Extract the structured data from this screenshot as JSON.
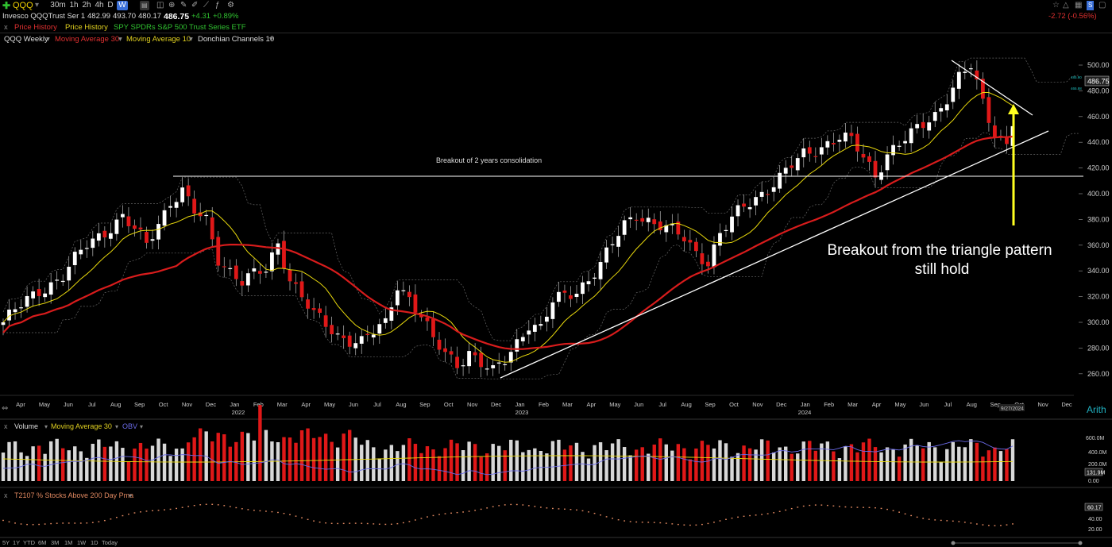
{
  "toolbar": {
    "symbol": "QQQ",
    "timeframes": [
      "30m",
      "1h",
      "2h",
      "4h",
      "D",
      "W"
    ],
    "active_timeframe": "W",
    "right_change": "-2.72 (-0.56%)"
  },
  "info": {
    "name": "Invesco QQQTrust Ser 1",
    "open": "482.99",
    "high": "493.70",
    "low": "480.17",
    "close": "486.75",
    "change": "+4.31",
    "change_pct": "+0.89%"
  },
  "tabs": [
    "Price History",
    "Price History",
    "SPY SPDRs S&P 500 Trust Series ETF"
  ],
  "studies": [
    {
      "label": "QQQ Weekly",
      "color": "#dddddd"
    },
    {
      "label": "Moving Average 30",
      "color": "#e03030"
    },
    {
      "label": "Moving Average 10",
      "color": "#e0d020"
    },
    {
      "label": "Donchian Channels 10",
      "color": "#dddddd"
    }
  ],
  "annotations": {
    "consolidation": "Breakout of 2 years consolidation",
    "triangle_line1": "Breakout from the triangle pattern",
    "triangle_line2": "still hold"
  },
  "price_axis": {
    "ticks": [
      "500.00",
      "480.00",
      "460.00",
      "440.00",
      "420.00",
      "400.00",
      "380.00",
      "360.00",
      "340.00",
      "320.00",
      "300.00",
      "280.00",
      "260.00"
    ],
    "last_price": "486.75",
    "small_hi": "485.90",
    "small_lo": "465.88"
  },
  "time_axis": {
    "months": [
      "Apr",
      "May",
      "Jun",
      "Jul",
      "Aug",
      "Sep",
      "Oct",
      "Nov",
      "Dec",
      "Jan",
      "Feb",
      "Mar",
      "Apr",
      "May",
      "Jun",
      "Jul",
      "Aug",
      "Sep",
      "Oct",
      "Nov",
      "Dec",
      "Jan",
      "Feb",
      "Mar",
      "Apr",
      "May",
      "Jun",
      "Jul",
      "Aug",
      "Sep",
      "Oct",
      "Nov",
      "Dec",
      "Jan",
      "Feb",
      "Mar",
      "Apr",
      "May",
      "Jun",
      "Jul",
      "Aug",
      "Sep",
      "Oct",
      "Nov",
      "Dec"
    ],
    "years": [
      "2022",
      "2023",
      "2024"
    ],
    "date_flag": "9/27/2024",
    "scale": "Arith"
  },
  "volume_panel": {
    "labels": [
      "Volume",
      "Moving Average 30",
      "OBV"
    ],
    "ticks": [
      "600.0M",
      "400.0M",
      "200.0M",
      "0.00"
    ],
    "last": "131.9M"
  },
  "breadth_panel": {
    "label": "T2107 % Stocks Above 200 Day Pma",
    "ticks": [
      "60.17",
      "40.00",
      "20.00"
    ]
  },
  "bottom_bar": [
    "5Y",
    "1Y",
    "YTD",
    "6M",
    "3M",
    "1M",
    "1W",
    "1D",
    "Today"
  ],
  "colors": {
    "up": "#ffffff",
    "down": "#e01818",
    "ma30": "#d81c1c",
    "ma10": "#e8d80c",
    "obv": "#6a6ae8",
    "breadth": "#e08860",
    "arrow": "#ffff20",
    "green": "#30c030"
  }
}
